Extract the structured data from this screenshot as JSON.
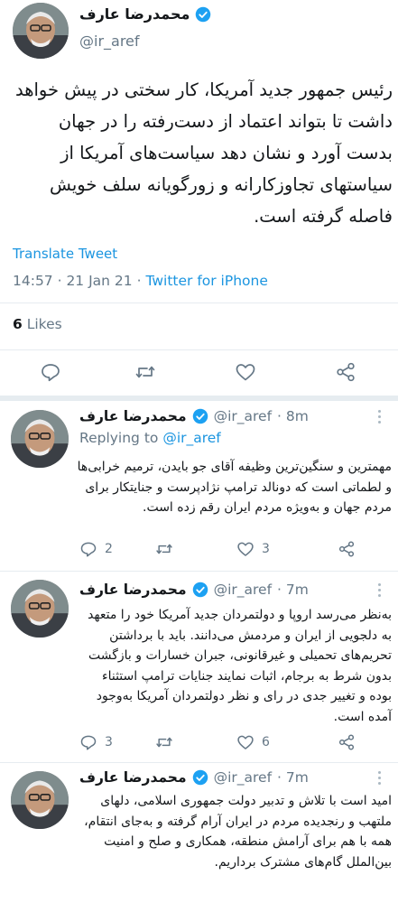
{
  "main_tweet": {
    "author_name": "محمدرضا عارف",
    "handle": "@ir_aref",
    "text": "رئیس جمهور جدید آمریکا، کار سختی در پیش خواهد داشت تا بتواند اعتماد از دست‌رفته را در جهان بدست آورد و نشان دهد سیاست‌های آمریکا از سیاستهای تجاوزکارانه و زورگویانه سلف خویش فاصله گرفته است.",
    "translate_label": "Translate Tweet",
    "timestamp": "14:57 · 21 Jan 21 · ",
    "source": "Twitter for iPhone",
    "likes_count": "6",
    "likes_label": "Likes",
    "icons": [
      "reply-icon",
      "retweet-icon",
      "like-icon",
      "share-icon"
    ]
  },
  "replies": [
    {
      "author_name": "محمدرضا عارف",
      "handle": "@ir_aref",
      "time": "· 8m",
      "replying_prefix": "Replying to ",
      "replying_mention": "@ir_aref",
      "text": "مهمترین و سنگین‌ترین وظیفه آقای جو بایدن، ترمیم خرابی‌ها و لطماتی است که دونالد ترامپ نژادپرست و جنایتکار برای مردم جهان و به‌ویژه مردم ایران رقم زده است.",
      "reply_count": "2",
      "like_count": "3"
    },
    {
      "author_name": "محمدرضا عارف",
      "handle": "@ir_aref",
      "time": "· 7m",
      "text": "به‌نظر می‌رسد اروپا و دولتمردان جدید آمریکا خود را متعهد به دلجویی از ایران و مردمش می‌دانند. باید با برداشتن تحریم‌های تحمیلی و غیرقانونی، جبران خسارات و بازگشت بدون شرط به برجام، اثبات نمایند جنایات ترامپ استثناء بوده و تغییر جدی در رای و نظر دولتمردان آمریکا به‌وجود آمده است.",
      "reply_count": "3",
      "like_count": "6"
    },
    {
      "author_name": "محمدرضا عارف",
      "handle": "@ir_aref",
      "time": "· 7m",
      "text": "امید است با تلاش و تدبیر دولت جمهوری اسلامی، دلهای ملتهب و رنجدیده مردم در ایران آرام گرفته و به‌جای انتقام، همه با هم برای آرامش منطقه، همکاری و صلح و امنیت بین‌الملل گام‌های مشترک برداریم."
    }
  ],
  "colors": {
    "accent": "#1b95e0",
    "muted": "#657786",
    "divider": "#e6ecf0",
    "text": "#14171a"
  }
}
